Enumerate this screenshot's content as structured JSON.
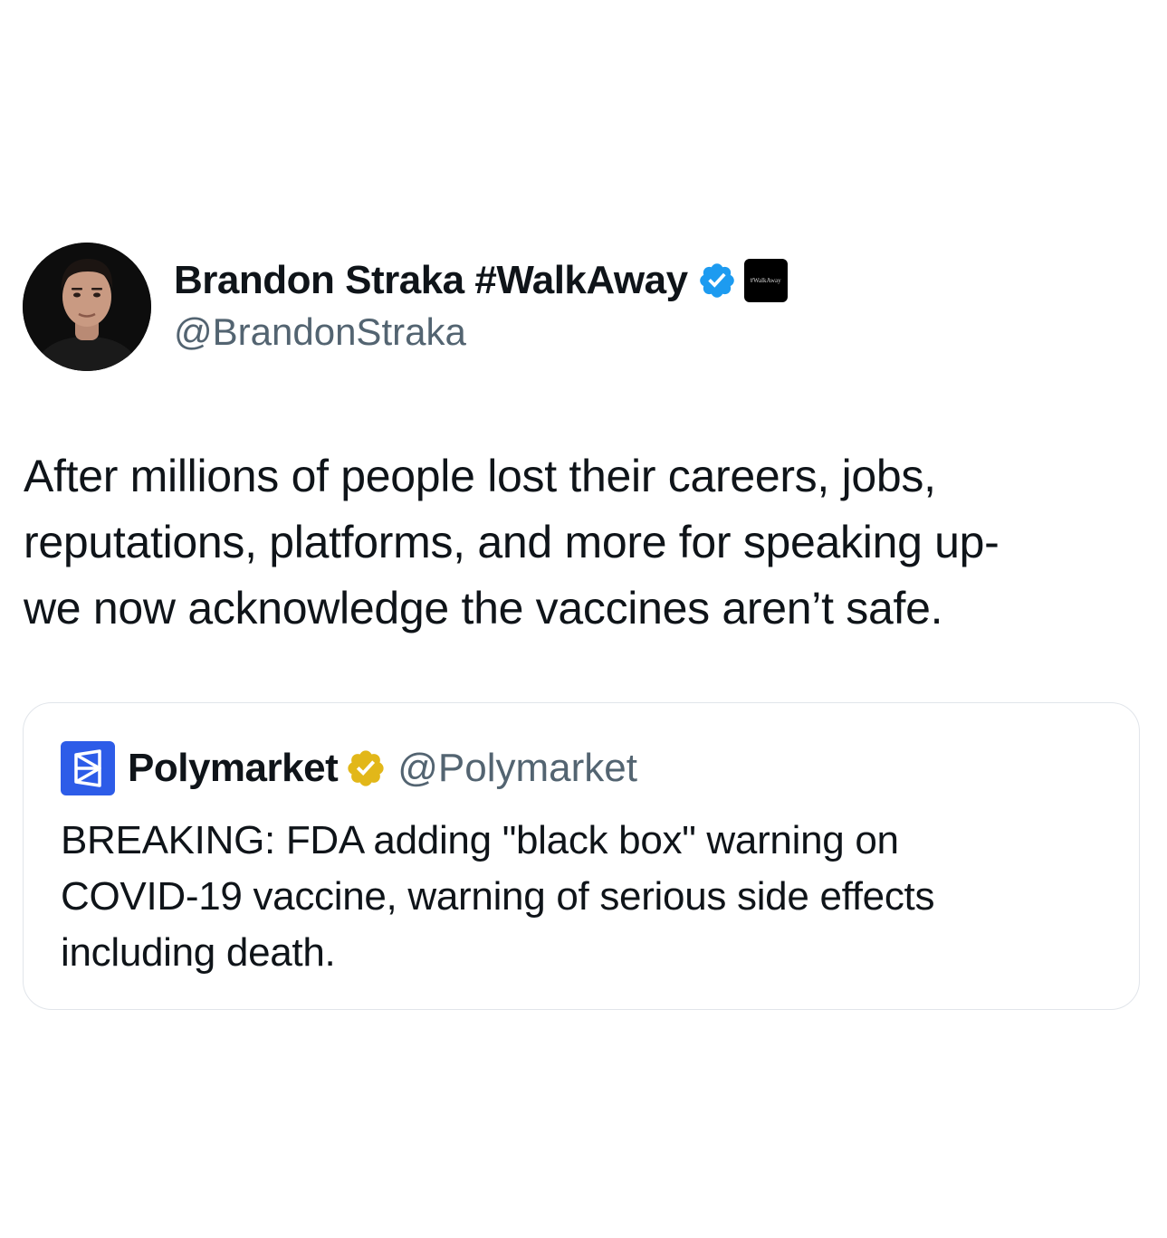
{
  "author": {
    "name": "Brandon Straka #WalkAway",
    "handle": "@BrandonStraka",
    "verified_color": "#1d9bf0",
    "affiliate_badge_text": "#WalkAway"
  },
  "tweet": {
    "lines": [
      "After millions of people lost their careers, jobs,",
      "reputations, platforms, and more for speaking up-",
      "we now acknowledge the vaccines aren’t safe."
    ]
  },
  "quote": {
    "name": "Polymarket",
    "handle": "@Polymarket",
    "logo_color": "#2d5ce8",
    "verified_color": "#e2b719",
    "lines": [
      "BREAKING: FDA adding \"black box\" warning on",
      "COVID-19 vaccine, warning of serious side effects",
      "including death."
    ]
  }
}
